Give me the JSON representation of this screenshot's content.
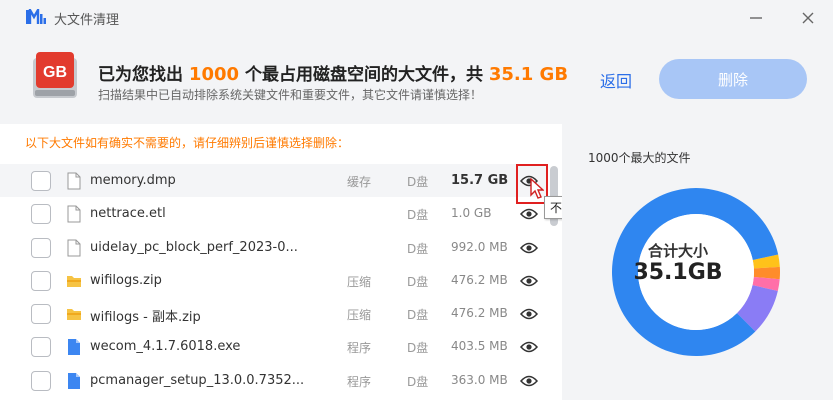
{
  "window": {
    "title": "大文件清理"
  },
  "header": {
    "title_prefix": "已为您找出",
    "file_count": "1000",
    "title_middle": "个最占用磁盘空间的大文件，共",
    "total_size": "35.1 GB",
    "subtitle": "扫描结果中已自动排除系统关键文件和重要文件，其它文件请谨慎选择！",
    "icon_text": "GB",
    "back_label": "返回",
    "delete_label": "删除"
  },
  "list": {
    "warning": "以下大文件如有确实不需要的，请仔细辨别后谨慎选择删除：",
    "tooltip": "不再显示该文件",
    "rows": [
      {
        "name": "memory.dmp",
        "tag": "缓存",
        "disk": "D盘",
        "size": "15.7 GB",
        "icon": "document-icon"
      },
      {
        "name": "nettrace.etl",
        "tag": "",
        "disk": "D盘",
        "size": "1.0 GB",
        "icon": "document-icon"
      },
      {
        "name": "uidelay_pc_block_perf_2023-0...",
        "tag": "",
        "disk": "D盘",
        "size": "992.0 MB",
        "icon": "document-icon"
      },
      {
        "name": "wifilogs.zip",
        "tag": "压缩",
        "disk": "D盘",
        "size": "476.2 MB",
        "icon": "zip-folder-icon"
      },
      {
        "name": "wifilogs - 副本.zip",
        "tag": "压缩",
        "disk": "D盘",
        "size": "476.2 MB",
        "icon": "zip-folder-icon"
      },
      {
        "name": "wecom_4.1.7.6018.exe",
        "tag": "程序",
        "disk": "D盘",
        "size": "403.5 MB",
        "icon": "program-icon"
      },
      {
        "name": "pcmanager_setup_13.0.0.7352...",
        "tag": "程序",
        "disk": "D盘",
        "size": "363.0 MB",
        "icon": "program-icon"
      }
    ]
  },
  "chart": {
    "title": "1000个最大的文件",
    "center_label": "合计大小",
    "center_value": "35.1GB",
    "colors": {
      "primary": "#2f86f0",
      "yellow": "#ffc21a",
      "orange": "#ff8c2a",
      "pink": "#ff6fa8",
      "purple": "#8a7cf5"
    }
  },
  "chart_data": {
    "type": "pie",
    "categories": [
      "memory.dmp",
      "nettrace.etl",
      "uidelay_pc_block_perf_2023-0...",
      "wifilogs.zip",
      "wifilogs - 副本.zip",
      "wecom_4.1.7.6018.exe",
      "pcmanager_setup_13.0.0.7352..."
    ],
    "values": [
      15.7,
      1.0,
      0.99,
      0.48,
      0.48,
      0.4,
      0.36
    ],
    "total": 35.1
  },
  "colors": {
    "accent": "#2b6ee8",
    "highlight": "#ff7a00",
    "delete_disabled": "#a8c6f6"
  }
}
